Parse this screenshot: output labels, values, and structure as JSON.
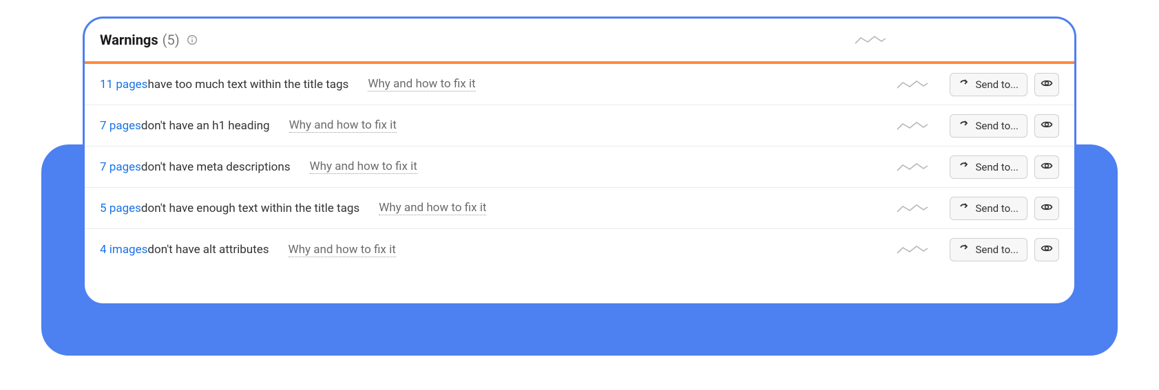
{
  "header": {
    "title": "Warnings",
    "count": "(5)"
  },
  "labels": {
    "why_link": "Why and how to fix it",
    "send_to": "Send to..."
  },
  "rows": [
    {
      "count_text": "11 pages",
      "message": " have too much text within the title tags"
    },
    {
      "count_text": "7 pages",
      "message": " don't have an h1 heading"
    },
    {
      "count_text": "7 pages",
      "message": " don't have meta descriptions"
    },
    {
      "count_text": "5 pages",
      "message": " don't have enough text within the title tags"
    },
    {
      "count_text": "4 images",
      "message": " don't have alt attributes"
    }
  ]
}
